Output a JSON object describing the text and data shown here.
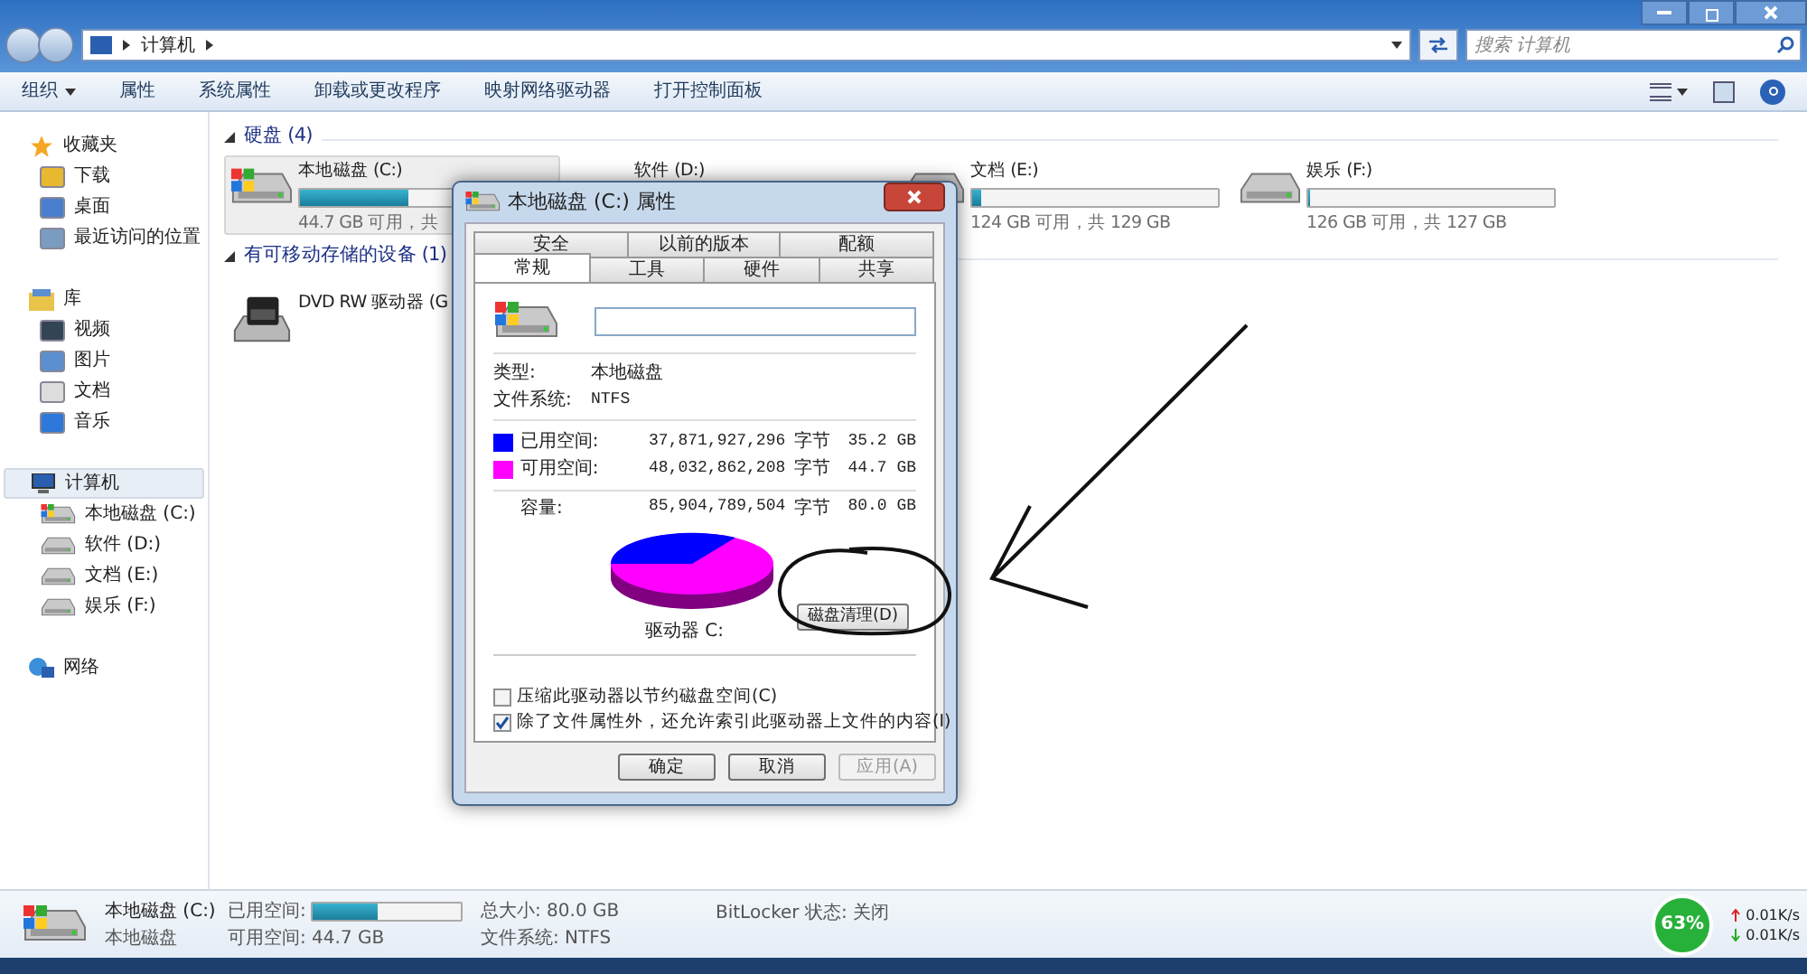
{
  "nav": {
    "breadcrumb": [
      "计算机"
    ],
    "search": {
      "placeholder": "搜索 计算机"
    }
  },
  "toolbar": {
    "items": [
      {
        "label": "组织",
        "kind": "menu"
      },
      {
        "label": "属性",
        "kind": "button"
      },
      {
        "label": "系统属性",
        "kind": "button"
      },
      {
        "label": "卸载或更改程序",
        "kind": "button"
      },
      {
        "label": "映射网络驱动器",
        "kind": "button"
      },
      {
        "label": "打开控制面板",
        "kind": "button"
      }
    ]
  },
  "sidebar": {
    "groups": [
      {
        "label": "收藏夹",
        "selected": false,
        "children": [
          {
            "label": "下载",
            "selected": false
          },
          {
            "label": "桌面",
            "selected": false
          },
          {
            "label": "最近访问的位置",
            "selected": false
          }
        ]
      },
      {
        "label": "库",
        "selected": false,
        "children": [
          {
            "label": "视频",
            "selected": false
          },
          {
            "label": "图片",
            "selected": false
          },
          {
            "label": "文档",
            "selected": false
          },
          {
            "label": "音乐",
            "selected": false
          }
        ]
      },
      {
        "label": "计算机",
        "selected": true,
        "children": [
          {
            "label": "本地磁盘 (C:)",
            "selected": false
          },
          {
            "label": "软件 (D:)",
            "selected": false
          },
          {
            "label": "文档 (E:)",
            "selected": false
          },
          {
            "label": "娱乐 (F:)",
            "selected": false
          }
        ]
      },
      {
        "label": "网络",
        "selected": false
      }
    ]
  },
  "sections": [
    {
      "title": "硬盘 (4)",
      "drives": [
        {
          "kind": "system",
          "name": "本地磁盘 (C:)",
          "level": 0.44,
          "free": "44.7 GB 可用，共",
          "selected": true
        },
        {
          "kind": "hidden",
          "name": "软件 (D:)",
          "selected": false
        },
        {
          "kind": "disk",
          "name": "文档 (E:)",
          "level": 0.04,
          "free": "124 GB 可用，共 129 GB",
          "selected": false
        },
        {
          "kind": "disk",
          "name": "娱乐 (F:)",
          "level": 0.01,
          "free": "126 GB 可用，共 127 GB",
          "selected": false
        }
      ]
    },
    {
      "title": "有可移动存储的设备 (1)",
      "drives": [
        {
          "kind": "dvd",
          "name": "DVD RW 驱动器 (G",
          "selected": false
        }
      ]
    }
  ],
  "dialog": {
    "title": "本地磁盘 (C:) 属性",
    "tab_rows": [
      [
        {
          "label": "安全",
          "selected": false
        },
        {
          "label": "以前的版本",
          "selected": false
        },
        {
          "label": "配额",
          "selected": false
        }
      ],
      [
        {
          "label": "常规",
          "selected": true
        },
        {
          "label": "工具",
          "selected": false
        },
        {
          "label": "硬件",
          "selected": false
        },
        {
          "label": "共享",
          "selected": false
        }
      ]
    ],
    "info": [
      {
        "label": "类型:",
        "value": "本地磁盘"
      },
      {
        "label": "文件系统:",
        "value": "NTFS"
      }
    ],
    "space": [
      {
        "label": "已用空间:",
        "bytes": "37,871,927,296",
        "unit": "字节",
        "size": "35.2 GB",
        "color": "#0000ff"
      },
      {
        "label": "可用空间:",
        "bytes": "48,032,862,208",
        "unit": "字节",
        "size": "44.7 GB",
        "color": "#ff00ff"
      }
    ],
    "capacity": {
      "label": "容量:",
      "bytes": "85,904,789,504",
      "unit": "字节",
      "size": "80.0 GB"
    },
    "drive_label": "驱动器 C:",
    "cleanup_button": "磁盘清理(D)",
    "checkboxes": [
      {
        "label": "压缩此驱动器以节约磁盘空间(C)",
        "checked": false
      },
      {
        "label": "除了文件属性外，还允许索引此驱动器上文件的内容(I)",
        "checked": true
      }
    ],
    "buttons": [
      {
        "label": "确定",
        "disabled": false
      },
      {
        "label": "取消",
        "disabled": false
      },
      {
        "label": "应用(A)",
        "disabled": true
      }
    ]
  },
  "details": {
    "name": "本地磁盘 (C:)",
    "type": "本地磁盘",
    "used_label": "已用空间:",
    "level": 0.44,
    "free": "可用空间: 44.7 GB",
    "total": "总大小: 80.0 GB",
    "fs": "文件系统: NTFS",
    "bitlocker": "BitLocker 状态: 关闭"
  },
  "monitor": {
    "percent": "63%",
    "up": "0.01K/s",
    "down": "0.01K/s"
  }
}
